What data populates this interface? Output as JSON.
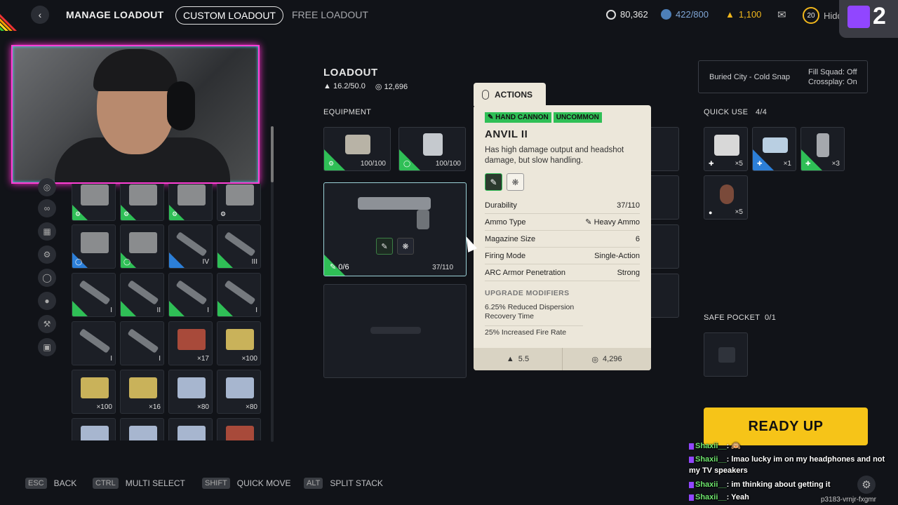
{
  "topbar": {
    "title": "MANAGE LOADOUT",
    "tabs": [
      {
        "label": "CUSTOM LOADOUT",
        "active": true
      },
      {
        "label": "FREE LOADOUT",
        "active": false
      }
    ],
    "coins": "80,362",
    "creds": "422/800",
    "tokens": "1,100",
    "level": "20",
    "username": "Hidd",
    "twitch_count": "2"
  },
  "loadout": {
    "title": "LOADOUT",
    "weight": "16.2/50.0",
    "value": "12,696",
    "equipment_label": "EQUIPMENT",
    "slots": [
      {
        "label": "100/100"
      },
      {
        "label": "100/100"
      }
    ],
    "weapon": {
      "ammo": "0/6",
      "durability": "37/110"
    }
  },
  "tooltip": {
    "actions_label": "ACTIONS",
    "tags": [
      "HAND CANNON",
      "UNCOMMON"
    ],
    "name": "ANVIL II",
    "description": "Has high damage output and headshot damage, but slow handling.",
    "stats": [
      {
        "label": "Durability",
        "value": "37/110"
      },
      {
        "label": "Ammo Type",
        "value": "Heavy Ammo"
      },
      {
        "label": "Magazine Size",
        "value": "6"
      },
      {
        "label": "Firing Mode",
        "value": "Single-Action"
      },
      {
        "label": "ARC Armor Penetration",
        "value": "Strong"
      }
    ],
    "upgrade_title": "UPGRADE MODIFIERS",
    "upgrades": [
      "6.25% Reduced Dispersion Recovery Time",
      "25% Increased Fire Rate"
    ],
    "weight": "5.5",
    "price": "4,296"
  },
  "right": {
    "map": "Buried City - Cold Snap",
    "fill_squad": "Fill Squad: Off",
    "crossplay": "Crossplay: On",
    "quick_use_label": "QUICK USE",
    "quick_use_count": "4/4",
    "quick_use": [
      "×5",
      "×1",
      "×3",
      "×5"
    ],
    "safe_pocket_label": "SAFE POCKET",
    "safe_pocket_count": "0/1",
    "ready_label": "READY UP"
  },
  "inventory": {
    "counts": [
      "",
      "",
      "",
      "",
      "",
      "",
      "IV",
      "III",
      "I",
      "II",
      "I",
      "I",
      "I",
      "I",
      "×17",
      "×100",
      "×100",
      "×16",
      "×80",
      "×80"
    ]
  },
  "hints": [
    {
      "key": "ESC",
      "label": "BACK"
    },
    {
      "key": "CTRL",
      "label": "MULTI SELECT"
    },
    {
      "key": "SHIFT",
      "label": "QUICK MOVE"
    },
    {
      "key": "ALT",
      "label": "SPLIT STACK"
    }
  ],
  "chat": [
    {
      "user": "Shaxii__",
      "msg": ": 🙉"
    },
    {
      "user": "Shaxii__",
      "msg": ": lmao lucky im on my headphones and not my TV speakers"
    },
    {
      "user": "Shaxii__",
      "msg": ": im thinking about getting it"
    },
    {
      "user": "Shaxii__",
      "msg": ": Yeah"
    }
  ],
  "footer_id": "p3183-vrnjr-fxgmr",
  "colors": {
    "uncommon": "#2fbf56",
    "rare": "#2c7fd8",
    "accent": "#f6c418",
    "webcam_border": "#ff3fd6"
  }
}
